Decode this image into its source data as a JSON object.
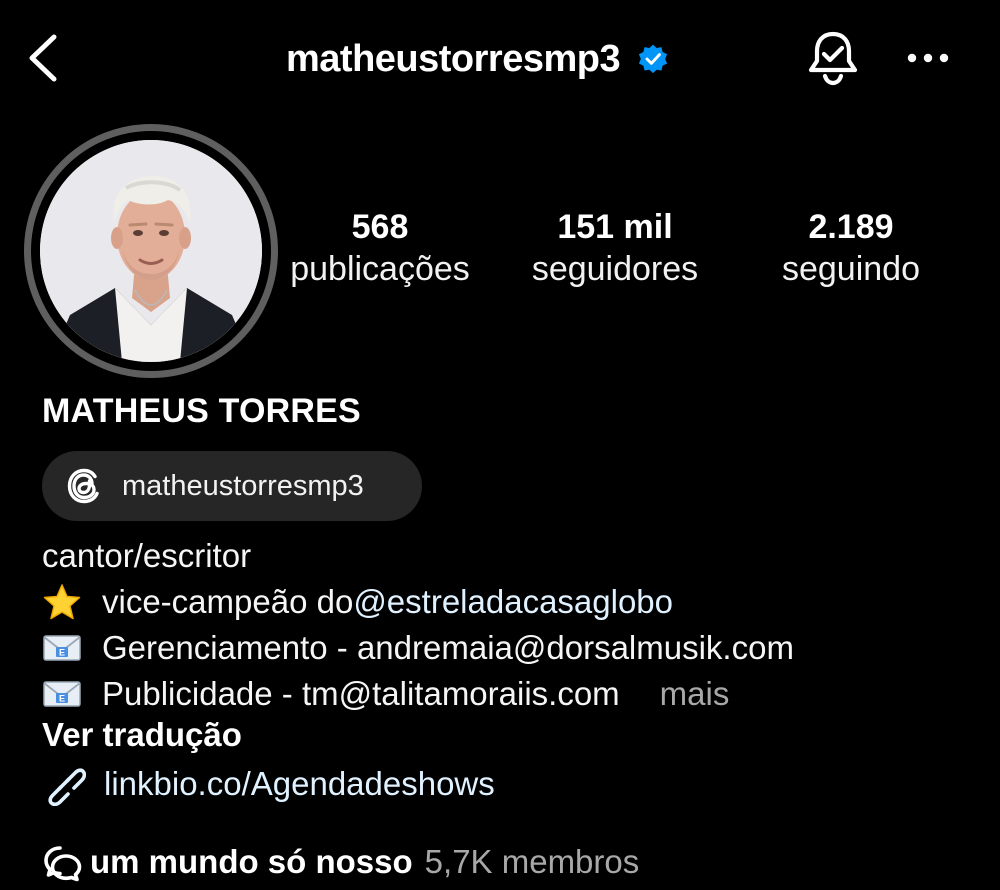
{
  "header": {
    "username": "matheustorresmp3",
    "icons": {
      "back": "chevron-left-icon",
      "verified": "verified-badge-icon",
      "notifications": "bell-check-icon",
      "more": "more-horizontal-icon"
    }
  },
  "profile": {
    "avatar_alt": "profile photo",
    "stats": {
      "posts": {
        "value": "568",
        "label": "publicações"
      },
      "followers": {
        "value": "151 mil",
        "label": "seguidores"
      },
      "following": {
        "value": "2.189",
        "label": "seguindo"
      }
    },
    "full_name": "MATHEUS TORRES",
    "threads": {
      "handle": "matheustorresmp3",
      "icon": "threads-icon"
    }
  },
  "bio": {
    "line1": "cantor/escritor",
    "line2": {
      "emoji": "⭐",
      "text": "vice-campeão do ",
      "mention": "@estreladacasaglobo"
    },
    "line3": {
      "emoji": "📧",
      "text": "Gerenciamento - andremaia@dorsalmusik.com"
    },
    "line4": {
      "emoji": "📧",
      "text": "Publicidade - tm@talitamoraiis.com",
      "more": "mais"
    },
    "translate": "Ver tradução"
  },
  "link": {
    "icon": "link-icon",
    "text": "linkbio.co/Agendadeshows"
  },
  "channel": {
    "icon": "broadcast-channel-icon",
    "name": "um mundo só nosso",
    "members": "5,7K membros"
  },
  "colors": {
    "background": "#000000",
    "text": "#f5f5f5",
    "secondary_text": "#a8a8a8",
    "link": "#e0f1ff",
    "verified": "#0095f6",
    "pill": "#262626",
    "avatar_ring": "#5f5f5f"
  }
}
